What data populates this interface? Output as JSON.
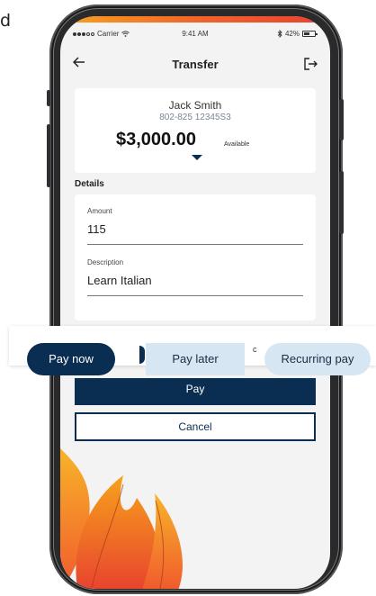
{
  "fragment_text": "d",
  "status_bar": {
    "carrier": "Carrier",
    "time": "9:41 AM",
    "battery": "42%"
  },
  "header": {
    "title": "Transfer",
    "back_icon": "arrow-left-icon",
    "logout_icon": "logout-icon"
  },
  "account": {
    "name": "Jack Smith",
    "number": "802-825 12345S3",
    "balance": "$3,000.00",
    "balance_label": "Available"
  },
  "details": {
    "section_label": "Details",
    "amount_label": "Amount",
    "amount_value": "115",
    "description_label": "Description",
    "description_value": "Learn Italian"
  },
  "payment_options": {
    "pay_now": "Pay now",
    "pay_later": "Pay later",
    "recurring": "Recurring pay",
    "selected": "Pay now",
    "partial_char": "c"
  },
  "actions": {
    "pay_label": "Pay",
    "cancel_label": "Cancel"
  },
  "colors": {
    "primary": "#0a2d52",
    "option_idle": "#d6e6f2",
    "flame_orange": "#f2652a",
    "flame_yellow": "#f7a21b",
    "flame_red": "#e8412f"
  }
}
